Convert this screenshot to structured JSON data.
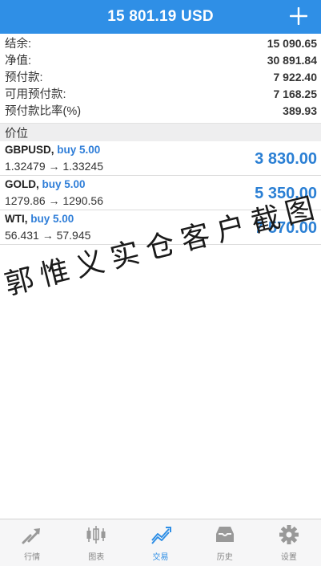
{
  "header": {
    "balance_title": "15 801.19 USD",
    "add_label": "+"
  },
  "summary": [
    {
      "label": "结余:",
      "value": "15 090.65"
    },
    {
      "label": "净值:",
      "value": "30 891.84"
    },
    {
      "label": "预付款:",
      "value": "7 922.40"
    },
    {
      "label": "可用预付款:",
      "value": "7 168.25"
    },
    {
      "label": "预付款比率(%)",
      "value": "389.93"
    }
  ],
  "section_title": "价位",
  "positions": [
    {
      "symbol": "GBPUSD,",
      "side": "buy 5.00",
      "prices": "1.32479 → 1.33245",
      "profit": "3 830.00"
    },
    {
      "symbol": "GOLD,",
      "side": "buy 5.00",
      "prices": "1279.86 → 1290.56",
      "profit": "5 350.00"
    },
    {
      "symbol": "WTI,",
      "side": "buy 5.00",
      "prices": "56.431 → 57.945",
      "profit": "7 570.00"
    }
  ],
  "watermark": [
    "郭",
    "惟",
    "义",
    "实",
    "仓",
    "客",
    "户",
    "截",
    "图"
  ],
  "tabs": [
    {
      "label": "行情",
      "icon": "quotes-icon",
      "active": false
    },
    {
      "label": "图表",
      "icon": "chart-icon",
      "active": false
    },
    {
      "label": "交易",
      "icon": "trade-icon",
      "active": true
    },
    {
      "label": "历史",
      "icon": "history-icon",
      "active": false
    },
    {
      "label": "设置",
      "icon": "settings-icon",
      "active": false
    }
  ],
  "colors": {
    "accent": "#2f8fe6",
    "profit": "#2a7fd4",
    "inactive": "#888888"
  }
}
